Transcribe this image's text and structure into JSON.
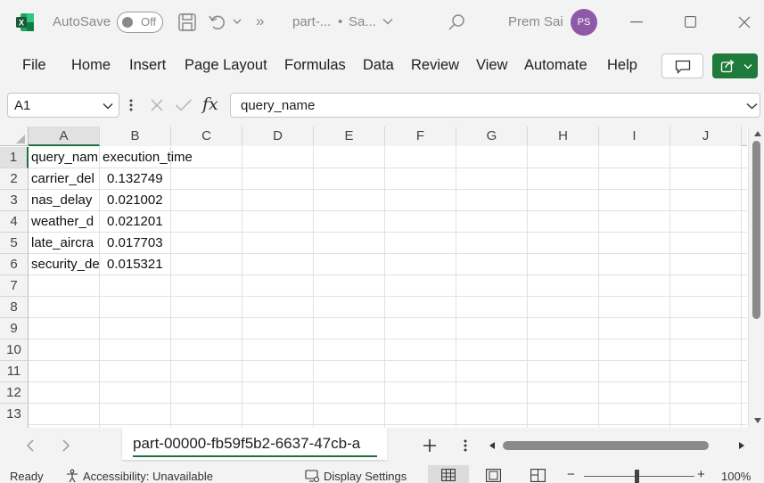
{
  "titlebar": {
    "autosave_label": "AutoSave",
    "autosave_state": "Off",
    "overflow": "»",
    "file_name": "part-...",
    "bullet": "•",
    "save_state": "Sa...",
    "user_name": "Prem Sai",
    "user_initials": "PS"
  },
  "menu": [
    "File",
    "Home",
    "Insert",
    "Page Layout",
    "Formulas",
    "Data",
    "Review",
    "View",
    "Automate",
    "Help"
  ],
  "formula_bar": {
    "name_box": "A1",
    "fx": "fx",
    "content": "query_name"
  },
  "sheet": {
    "columns": [
      "A",
      "B",
      "C",
      "D",
      "E",
      "F",
      "G",
      "H",
      "I",
      "J"
    ],
    "rows": [
      "1",
      "2",
      "3",
      "4",
      "5",
      "6",
      "7",
      "8",
      "9",
      "10",
      "11",
      "12",
      "13"
    ],
    "cells": {
      "A1": "query_nam",
      "B1": "execution_time",
      "A2": "carrier_del",
      "B2": "0.132749",
      "A3": "nas_delay",
      "B3": "0.021002",
      "A4": "weather_d",
      "B4": "0.021201",
      "A5": "late_aircra",
      "B5": "0.017703",
      "A6": "security_de",
      "B6": "0.015321"
    }
  },
  "sheet_tab": "part-00000-fb59f5b2-6637-47cb-a",
  "status": {
    "ready": "Ready",
    "accessibility": "Accessibility: Unavailable",
    "display_settings": "Display Settings",
    "zoom": "100%",
    "zoom_minus": "−",
    "zoom_plus": "+"
  },
  "colors": {
    "excel_green": "#1e7145",
    "share_green": "#1e7b3c",
    "avatar": "#8e5aa8",
    "tab_underline": "#1e7145"
  }
}
